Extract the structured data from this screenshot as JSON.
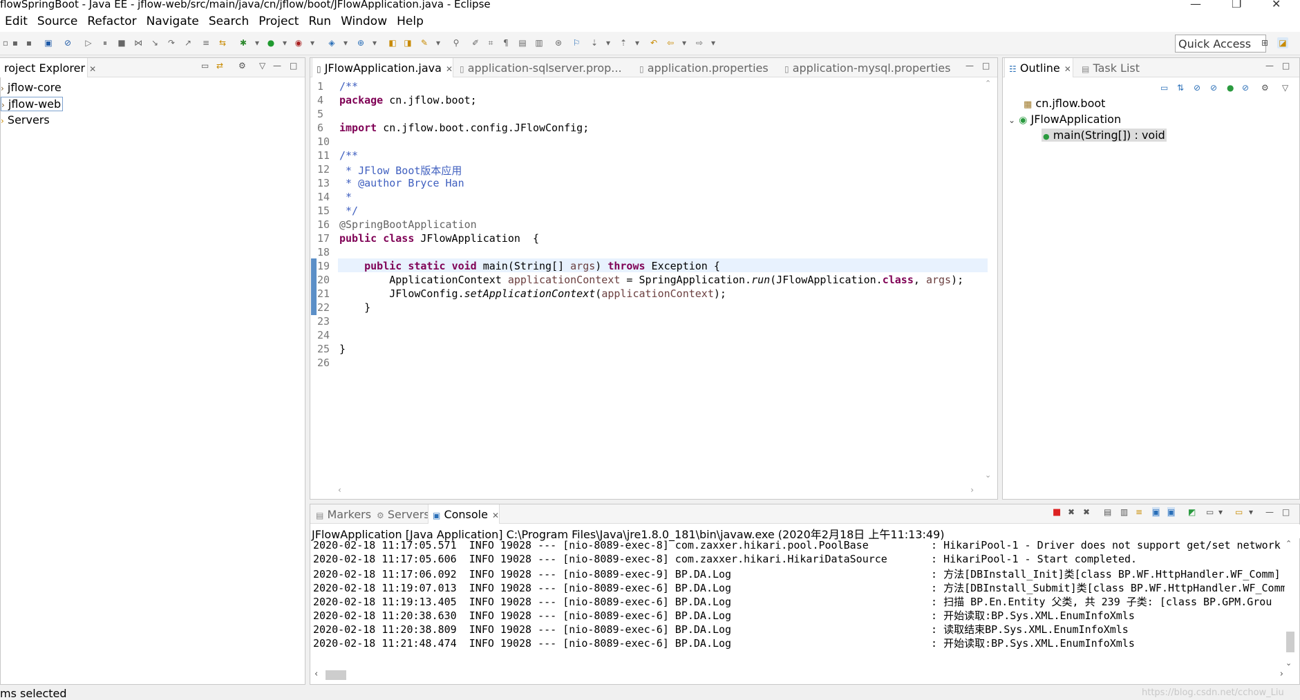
{
  "window": {
    "title": "flowSpringBoot - Java EE - jflow-web/src/main/java/cn/jflow/boot/JFlowApplication.java - Eclipse",
    "minimize": "—",
    "restore": "❐",
    "close": "✕"
  },
  "menu": [
    "Edit",
    "Source",
    "Refactor",
    "Navigate",
    "Search",
    "Project",
    "Run",
    "Window",
    "Help"
  ],
  "toolbar": {
    "quick_access": "Quick Access"
  },
  "explorer": {
    "tab": "roject Explorer",
    "items": [
      "jflow-core",
      "jflow-web",
      "Servers"
    ]
  },
  "editor": {
    "tabs": [
      "JFlowApplication.java",
      "application-sqlserver.prop...",
      "application.properties",
      "application-mysql.properties"
    ],
    "lines": [
      {
        "n": "1",
        "code": "/**"
      },
      {
        "n": "4",
        "code": "package cn.jflow.boot;"
      },
      {
        "n": "5",
        "code": ""
      },
      {
        "n": "6",
        "code": "import cn.jflow.boot.config.JFlowConfig;"
      },
      {
        "n": "10",
        "code": ""
      },
      {
        "n": "11",
        "code": "/**"
      },
      {
        "n": "12",
        "code": " * JFlow Boot版本应用"
      },
      {
        "n": "13",
        "code": " * @author Bryce Han"
      },
      {
        "n": "14",
        "code": " *"
      },
      {
        "n": "15",
        "code": " */"
      },
      {
        "n": "16",
        "code": "@SpringBootApplication"
      },
      {
        "n": "17",
        "code": "public class JFlowApplication  {"
      },
      {
        "n": "18",
        "code": ""
      },
      {
        "n": "19",
        "code": "    public static void main(String[] args) throws Exception {"
      },
      {
        "n": "20",
        "code": "        ApplicationContext applicationContext = SpringApplication.run(JFlowApplication.class, args);"
      },
      {
        "n": "21",
        "code": "        JFlowConfig.setApplicationContext(applicationContext);"
      },
      {
        "n": "22",
        "code": "    }"
      },
      {
        "n": "23",
        "code": ""
      },
      {
        "n": "24",
        "code": ""
      },
      {
        "n": "25",
        "code": "}"
      },
      {
        "n": "26",
        "code": ""
      }
    ]
  },
  "outline": {
    "tabs": [
      "Outline",
      "Task List"
    ],
    "items": [
      "cn.jflow.boot",
      "JFlowApplication",
      "main(String[]) : void"
    ]
  },
  "console": {
    "tabs": [
      "Markers",
      "Servers",
      "Console"
    ],
    "header": "JFlowApplication [Java Application] C:\\Program Files\\Java\\jre1.8.0_181\\bin\\javaw.exe (2020年2月18日 上午11:13:49)",
    "lines": [
      "2020-02-18 11:17:05.571  INFO 19028 --- [nio-8089-exec-8] com.zaxxer.hikari.pool.PoolBase          : HikariPool-1 - Driver does not support get/set network",
      "2020-02-18 11:17:05.606  INFO 19028 --- [nio-8089-exec-8] com.zaxxer.hikari.HikariDataSource       : HikariPool-1 - Start completed.",
      "2020-02-18 11:17:06.092  INFO 19028 --- [nio-8089-exec-9] BP.DA.Log                                : 方法[DBInstall_Init]类[class BP.WF.HttpHandler.WF_Comm]",
      "2020-02-18 11:19:07.013  INFO 19028 --- [nio-8089-exec-6] BP.DA.Log                                : 方法[DBInstall_Submit]类[class BP.WF.HttpHandler.WF_Comm",
      "2020-02-18 11:19:13.405  INFO 19028 --- [nio-8089-exec-6] BP.DA.Log                                : 扫描 BP.En.Entity 父类, 共 239 子类: [class BP.GPM.Grou",
      "2020-02-18 11:20:38.630  INFO 19028 --- [nio-8089-exec-6] BP.DA.Log                                : 开始读取:BP.Sys.XML.EnumInfoXmls",
      "2020-02-18 11:20:38.809  INFO 19028 --- [nio-8089-exec-6] BP.DA.Log                                : 读取结束BP.Sys.XML.EnumInfoXmls",
      "2020-02-18 11:21:48.474  INFO 19028 --- [nio-8089-exec-6] BP.DA.Log                                : 开始读取:BP.Sys.XML.EnumInfoXmls"
    ]
  },
  "status": {
    "left": "ms selected",
    "watermark": "https://blog.csdn.net/cchow_Liu"
  }
}
